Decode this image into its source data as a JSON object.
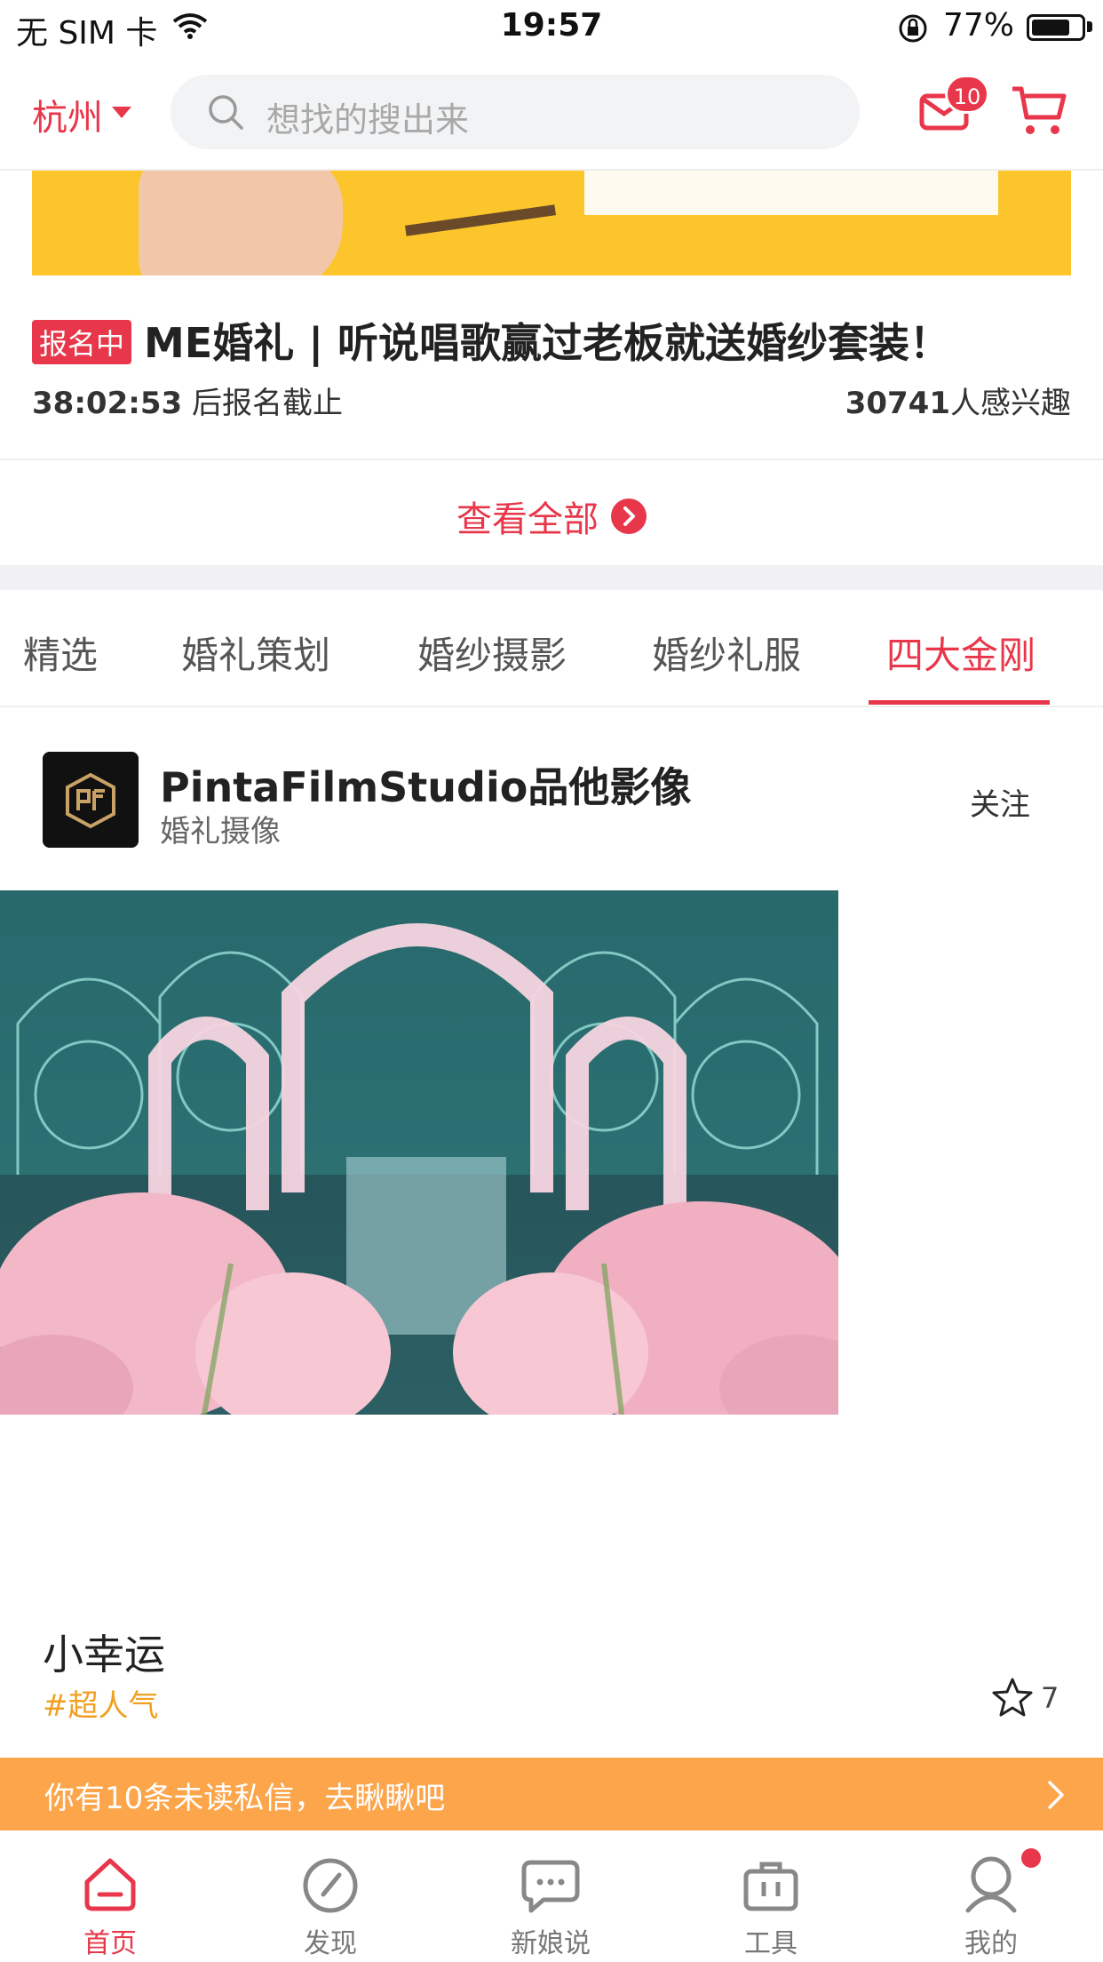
{
  "status_bar": {
    "carrier": "无 SIM 卡",
    "time": "19:57",
    "battery": "77%",
    "battery_level": 0.77
  },
  "header": {
    "city": "杭州",
    "search_placeholder": "想找的搜出来",
    "message_badge": "10"
  },
  "event": {
    "tag": "报名中",
    "title": "ME婚礼 | 听说唱歌赢过老板就送婚纱套装！",
    "countdown": "38:02:53",
    "countdown_suffix": " 后报名截止",
    "interest_count": "30741",
    "interest_suffix": "人感兴趣"
  },
  "view_all": "查看全部",
  "tabs": [
    "精选",
    "婚礼策划",
    "婚纱摄影",
    "婚纱礼服",
    "四大金刚"
  ],
  "active_tab": "四大金刚",
  "post": {
    "studio_name": "PintaFilmStudio品他影像",
    "studio_category": "婚礼摄像",
    "follow": "关注",
    "title": "小幸运",
    "tag": "#超人气",
    "likes": "7"
  },
  "toast": {
    "text": "你有10条未读私信，去瞅瞅吧"
  },
  "tabbar": [
    {
      "label": "首页",
      "icon": "home-icon"
    },
    {
      "label": "发现",
      "icon": "discover-icon"
    },
    {
      "label": "新娘说",
      "icon": "chat-bubble-icon"
    },
    {
      "label": "工具",
      "icon": "toolbox-icon"
    },
    {
      "label": "我的",
      "icon": "profile-icon"
    }
  ],
  "colors": {
    "accent": "#e8374a",
    "toast": "#fca54a",
    "tag_orange": "#f0a020"
  }
}
